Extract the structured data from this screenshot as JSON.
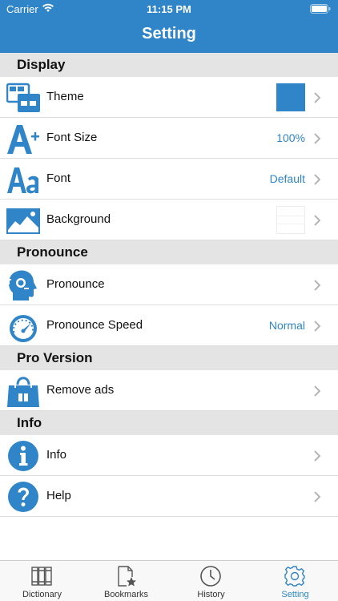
{
  "status_bar": {
    "carrier": "Carrier",
    "time": "11:15 PM"
  },
  "header": {
    "title": "Setting"
  },
  "sections": [
    {
      "title": "Display"
    },
    {
      "title": "Pronounce"
    },
    {
      "title": "Pro Version"
    },
    {
      "title": "Info"
    }
  ],
  "rows": {
    "theme": {
      "label": "Theme",
      "swatch_color": "#2f85c7"
    },
    "font_size": {
      "label": "Font Size",
      "value": "100%"
    },
    "font": {
      "label": "Font",
      "value": "Default"
    },
    "background": {
      "label": "Background"
    },
    "pronounce": {
      "label": "Pronounce"
    },
    "pronounce_speed": {
      "label": "Pronounce Speed",
      "value": "Normal"
    },
    "remove_ads": {
      "label": "Remove ads"
    },
    "info": {
      "label": "Info"
    },
    "help": {
      "label": "Help"
    }
  },
  "tabbar": {
    "tabs": [
      {
        "label": "Dictionary",
        "icon": "books-icon"
      },
      {
        "label": "Bookmarks",
        "icon": "bookmark-star-icon"
      },
      {
        "label": "History",
        "icon": "clock-icon"
      },
      {
        "label": "Setting",
        "icon": "gear-icon",
        "active": true
      }
    ]
  },
  "colors": {
    "accent": "#2f85c7",
    "section_bg": "#e4e4e4"
  }
}
